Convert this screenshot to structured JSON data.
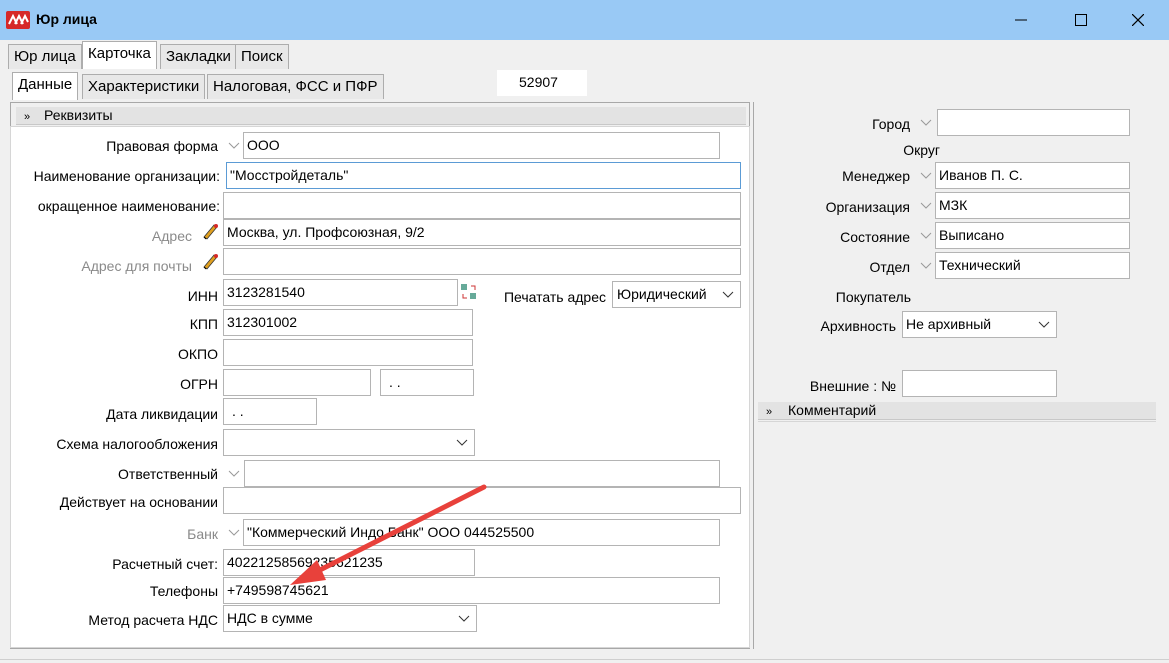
{
  "window": {
    "title": "Юр лица",
    "minimize": "—",
    "maximize": "☐",
    "close": "✕"
  },
  "top_tabs": [
    "Юр лица",
    "Карточка",
    "Закладки",
    "Поиск"
  ],
  "sub_tabs": [
    "Данные",
    "Характеристики",
    "Налоговая, ФСС и ПФР"
  ],
  "record_id": "52907",
  "requisites": {
    "header": "Реквизиты",
    "legal_form": {
      "label": "Правовая форма",
      "value": "ООО"
    },
    "org_name": {
      "label": "Наименование организации:",
      "value": "\"Мосстройдеталь\""
    },
    "short_name": {
      "label": "окращенное наименование:",
      "value": ""
    },
    "address": {
      "label": "Адрес",
      "value": "Москва, ул. Профсоюзная, 9/2"
    },
    "mail_address": {
      "label": "Адрес для почты",
      "value": ""
    },
    "inn": {
      "label": "ИНН",
      "value": "3123281540"
    },
    "print_address": {
      "label": "Печатать адрес",
      "value": "Юридический"
    },
    "kpp": {
      "label": "КПП",
      "value": "312301002"
    },
    "okpo": {
      "label": "ОКПО",
      "value": ""
    },
    "ogrn": {
      "label": "ОГРН",
      "value": "",
      "date": " .  ."
    },
    "liquidation_date": {
      "label": "Дата ликвидации",
      "value": " .  ."
    },
    "tax_scheme": {
      "label": "Схема налогообложения",
      "value": ""
    },
    "responsible": {
      "label": "Ответственный",
      "value": ""
    },
    "basis": {
      "label": "Действует на основании",
      "value": ""
    },
    "bank": {
      "label": "Банк",
      "value": "\"Коммерческий Индо Банк\" ООО  044525500"
    },
    "account": {
      "label": "Расчетный счет:",
      "value": "40221258569235621235"
    },
    "phones": {
      "label": "Телефоны",
      "value": "+749598745621"
    },
    "vat_method": {
      "label": "Метод расчета НДС",
      "value": "НДС в сумме"
    }
  },
  "right": {
    "city": {
      "label": "Город",
      "value": ""
    },
    "district": {
      "label": "Округ"
    },
    "manager": {
      "label": "Менеджер",
      "value": "Иванов П. С."
    },
    "organization": {
      "label": "Организация",
      "value": "МЗК"
    },
    "state": {
      "label": "Состояние",
      "value": "Выписано"
    },
    "department": {
      "label": "Отдел",
      "value": "Технический"
    },
    "buyer": {
      "label": "Покупатель"
    },
    "archive": {
      "label": "Архивность",
      "value": "Не архивный"
    },
    "external": {
      "label": "Внешние : №",
      "value": ""
    },
    "comment_header": "Комментарий"
  },
  "colors": {
    "titlebar": "#99c9f5",
    "arrow": "#e8413b",
    "focus": "#5b9bd5"
  }
}
